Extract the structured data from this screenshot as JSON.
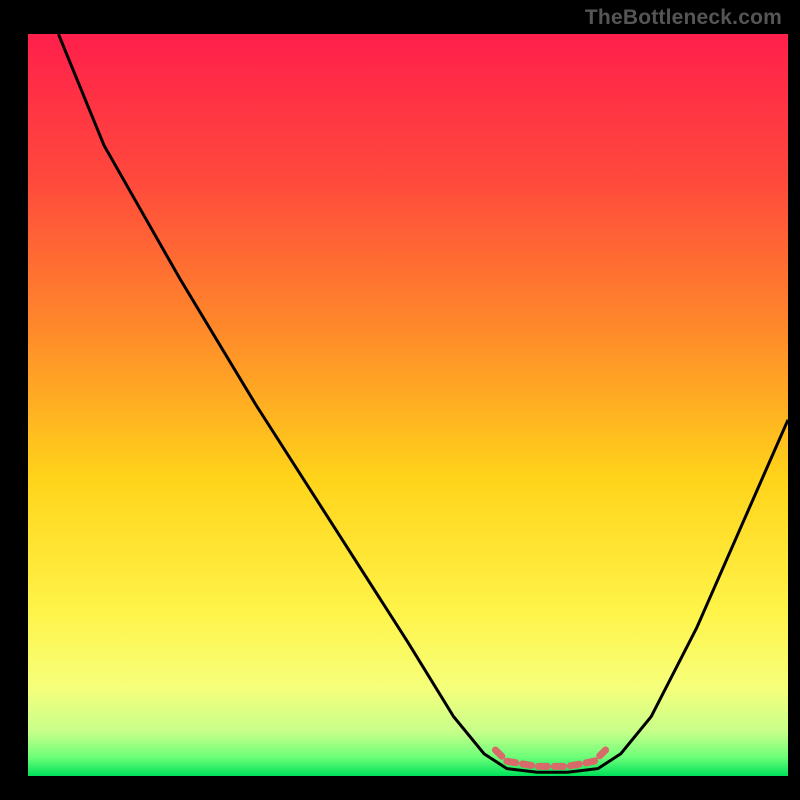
{
  "watermark": "TheBottleneck.com",
  "chart_data": {
    "type": "line",
    "title": "",
    "xlabel": "",
    "ylabel": "",
    "xlim": [
      0,
      100
    ],
    "ylim": [
      0,
      100
    ],
    "gradient_stops": [
      {
        "offset": 0.0,
        "color": "#ff1f4b"
      },
      {
        "offset": 0.2,
        "color": "#ff4a3c"
      },
      {
        "offset": 0.4,
        "color": "#ff8a2a"
      },
      {
        "offset": 0.6,
        "color": "#ffd41a"
      },
      {
        "offset": 0.78,
        "color": "#fff44a"
      },
      {
        "offset": 0.88,
        "color": "#f6ff7a"
      },
      {
        "offset": 0.94,
        "color": "#c8ff8a"
      },
      {
        "offset": 0.975,
        "color": "#6cff78"
      },
      {
        "offset": 1.0,
        "color": "#00e05a"
      }
    ],
    "series": [
      {
        "name": "bottleneck-curve",
        "stroke": "#000000",
        "points": [
          {
            "x": 4.0,
            "y": 100.0
          },
          {
            "x": 10.0,
            "y": 85.0
          },
          {
            "x": 20.0,
            "y": 67.0
          },
          {
            "x": 30.0,
            "y": 50.0
          },
          {
            "x": 40.0,
            "y": 34.0
          },
          {
            "x": 50.0,
            "y": 18.0
          },
          {
            "x": 56.0,
            "y": 8.0
          },
          {
            "x": 60.0,
            "y": 3.0
          },
          {
            "x": 63.0,
            "y": 1.0
          },
          {
            "x": 67.0,
            "y": 0.5
          },
          {
            "x": 71.0,
            "y": 0.5
          },
          {
            "x": 75.0,
            "y": 1.0
          },
          {
            "x": 78.0,
            "y": 3.0
          },
          {
            "x": 82.0,
            "y": 8.0
          },
          {
            "x": 88.0,
            "y": 20.0
          },
          {
            "x": 94.0,
            "y": 34.0
          },
          {
            "x": 100.0,
            "y": 48.0
          }
        ]
      },
      {
        "name": "optimal-zone-marker",
        "stroke": "#d86a6a",
        "dashed": true,
        "points": [
          {
            "x": 61.5,
            "y": 3.5
          },
          {
            "x": 63.0,
            "y": 2.0
          },
          {
            "x": 67.0,
            "y": 1.3
          },
          {
            "x": 71.0,
            "y": 1.3
          },
          {
            "x": 74.5,
            "y": 2.0
          },
          {
            "x": 76.0,
            "y": 3.5
          }
        ]
      }
    ]
  }
}
